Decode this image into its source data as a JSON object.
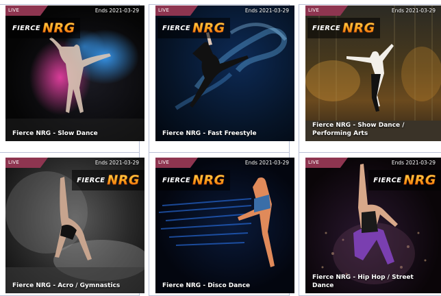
{
  "competitions": [
    {
      "badge": "LIVE",
      "ends": "Ends 2021-03-29",
      "logo_word": "FIERCE",
      "logo_mark": "NRG",
      "title": "Fierce NRG - Slow Dance",
      "theme": "pink-blue-powder"
    },
    {
      "badge": "LIVE",
      "ends": "Ends 2021-03-29",
      "logo_word": "FIERCE",
      "logo_mark": "NRG",
      "title": "Fierce NRG - Fast Freestyle",
      "theme": "blue-smoke"
    },
    {
      "badge": "LIVE",
      "ends": "Ends 2021-03-29",
      "logo_word": "FIERCE",
      "logo_mark": "NRG",
      "title": "Fierce NRG - Show Dance / Performing Arts",
      "theme": "urban-night"
    },
    {
      "badge": "LIVE",
      "ends": "Ends 2021-03-29",
      "logo_word": "FIERCE",
      "logo_mark": "NRG",
      "title": "Fierce NRG - Acro / Gymnastics",
      "theme": "grey-dust"
    },
    {
      "badge": "LIVE",
      "ends": "Ends 2021-03-29",
      "logo_word": "FIERCE",
      "logo_mark": "NRG",
      "title": "Fierce NRG - Disco Dance",
      "theme": "blue-motion"
    },
    {
      "badge": "LIVE",
      "ends": "Ends 2021-03-29",
      "logo_word": "FIERCE",
      "logo_mark": "NRG",
      "title": "Fierce NRG - Hip Hop / Street Dance",
      "theme": "purple-splash"
    }
  ],
  "colors": {
    "live_badge": "#8e3550",
    "frame_border": "#b9c0d6",
    "logo_orange": "#f7a21b"
  }
}
